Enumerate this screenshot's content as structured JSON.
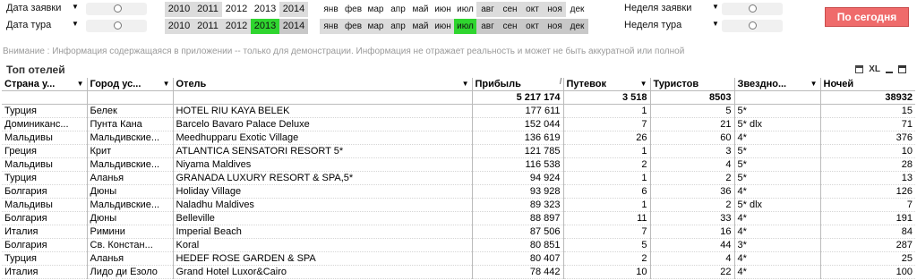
{
  "filters": {
    "order_date_label": "Дата заявки",
    "tour_date_label": "Дата тура",
    "order_week_label": "Неделя заявки",
    "tour_week_label": "Неделя тура",
    "dropdown_icon": "triangle-down-icon",
    "years": [
      {
        "label": "2010",
        "state_row1": "alt",
        "state_row2": "alt"
      },
      {
        "label": "2011",
        "state_row1": "alt",
        "state_row2": "alt"
      },
      {
        "label": "2012",
        "state_row1": "none",
        "state_row2": "alt"
      },
      {
        "label": "2013",
        "state_row1": "none",
        "state_row2": "selected"
      },
      {
        "label": "2014",
        "state_row1": "alt",
        "state_row2": "excluded"
      }
    ],
    "months": [
      {
        "label": "янв",
        "state_row1": "none",
        "state_row2": "alt"
      },
      {
        "label": "фев",
        "state_row1": "none",
        "state_row2": "alt"
      },
      {
        "label": "мар",
        "state_row1": "none",
        "state_row2": "alt"
      },
      {
        "label": "апр",
        "state_row1": "none",
        "state_row2": "alt"
      },
      {
        "label": "май",
        "state_row1": "none",
        "state_row2": "alt"
      },
      {
        "label": "июн",
        "state_row1": "none",
        "state_row2": "alt"
      },
      {
        "label": "июл",
        "state_row1": "none",
        "state_row2": "selected"
      },
      {
        "label": "авг",
        "state_row1": "alt",
        "state_row2": "excluded"
      },
      {
        "label": "сен",
        "state_row1": "alt",
        "state_row2": "excluded"
      },
      {
        "label": "окт",
        "state_row1": "alt",
        "state_row2": "excluded"
      },
      {
        "label": "ноя",
        "state_row1": "alt",
        "state_row2": "excluded"
      },
      {
        "label": "дек",
        "state_row1": "none",
        "state_row2": "excluded"
      }
    ]
  },
  "today_button": "По сегодня",
  "disclaimer": "Внимание :  Информация содержащаяся в приложении -- только для демонстрации.  Информация не отражает реальность и может не быть аккуратной или полной",
  "table": {
    "title": "Топ отелей",
    "tools": {
      "xl_label": "XL"
    },
    "columns": [
      {
        "label": "Страна у...",
        "dropdown": true
      },
      {
        "label": "Город ус...",
        "dropdown": true
      },
      {
        "label": "Отель",
        "dropdown": true
      },
      {
        "label": "Прибыль",
        "dropdown": false
      },
      {
        "label": "Путевок",
        "dropdown": true
      },
      {
        "label": "Туристов",
        "dropdown": false
      },
      {
        "label": "Звездно...",
        "dropdown": true
      },
      {
        "label": "Ночей",
        "dropdown": false
      }
    ],
    "totals": [
      "",
      "",
      "",
      "5 217 174",
      "3 518",
      "8503",
      "",
      "38932"
    ],
    "rows": [
      [
        "Турция",
        "Белек",
        "HOTEL RIU KAYA BELEK",
        "177 611",
        "1",
        "5",
        "5*",
        "15"
      ],
      [
        "Доминиканс...",
        "Пунта Кана",
        "Barcelo Bavaro Palace Deluxe",
        "152 044",
        "7",
        "21",
        "5* dlx",
        "71"
      ],
      [
        "Мальдивы",
        "Мальдивские...",
        "Meedhupparu Exotic Village",
        "136 619",
        "26",
        "60",
        "4*",
        "376"
      ],
      [
        "Греция",
        "Крит",
        "ATLANTICA SENSATORI RESORT 5*",
        "121 785",
        "1",
        "3",
        "5*",
        "10"
      ],
      [
        "Мальдивы",
        "Мальдивские...",
        "Niyama Maldives",
        "116 538",
        "2",
        "4",
        "5*",
        "28"
      ],
      [
        "Турция",
        "Аланья",
        "GRANADA LUXURY RESORT & SPA,5*",
        "94 924",
        "1",
        "2",
        "5*",
        "13"
      ],
      [
        "Болгария",
        "Дюны",
        "Holiday Village",
        "93 928",
        "6",
        "36",
        "4*",
        "126"
      ],
      [
        "Мальдивы",
        "Мальдивские...",
        "Naladhu Maldives",
        "89 323",
        "1",
        "2",
        "5* dlx",
        "7"
      ],
      [
        "Болгария",
        "Дюны",
        "Belleville",
        "88 897",
        "11",
        "33",
        "4*",
        "191"
      ],
      [
        "Италия",
        "Римини",
        "Imperial Beach",
        "87 506",
        "7",
        "16",
        "4*",
        "84"
      ],
      [
        "Болгария",
        "Св. Констан...",
        "Koral",
        "80 851",
        "5",
        "44",
        "3*",
        "287"
      ],
      [
        "Турция",
        "Аланья",
        "HEDEF ROSE GARDEN & SPA",
        "80 407",
        "2",
        "4",
        "4*",
        "25"
      ],
      [
        "Италия",
        "Лидо ди Езоло",
        "Grand Hotel Luxor&Cairo",
        "78 442",
        "10",
        "22",
        "4*",
        "100"
      ]
    ]
  }
}
